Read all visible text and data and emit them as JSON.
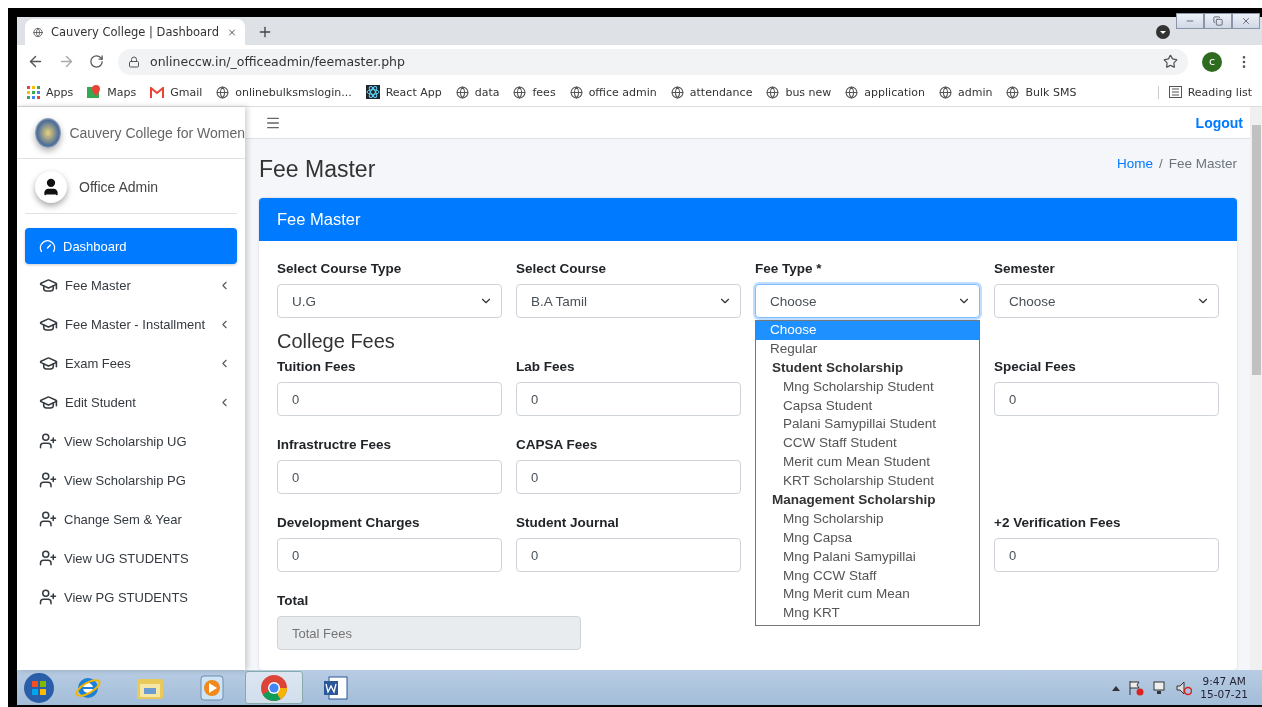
{
  "browser": {
    "tab_title": "Cauvery College | Dashboard",
    "url": "onlineccw.in/_officeadmin/feemaster.php",
    "profile_initial": "c",
    "bookmarks": [
      {
        "label": "Apps",
        "kind": "apps"
      },
      {
        "label": "Maps",
        "kind": "maps"
      },
      {
        "label": "Gmail",
        "kind": "gmail"
      },
      {
        "label": "onlinebulksmslogin...",
        "kind": "globe"
      },
      {
        "label": "React App",
        "kind": "react"
      },
      {
        "label": "data",
        "kind": "globe"
      },
      {
        "label": "fees",
        "kind": "globe"
      },
      {
        "label": "office admin",
        "kind": "globe"
      },
      {
        "label": "attendance",
        "kind": "globe"
      },
      {
        "label": "bus new",
        "kind": "globe"
      },
      {
        "label": "application",
        "kind": "globe"
      },
      {
        "label": "admin",
        "kind": "globe"
      },
      {
        "label": "Bulk SMS",
        "kind": "globe"
      }
    ],
    "reading_list": "Reading list"
  },
  "sidebar": {
    "brand": "Cauvery College for Women",
    "user": "Office Admin",
    "items": [
      {
        "label": "Dashboard",
        "kind": "gauge",
        "selected": true,
        "expandable": false
      },
      {
        "label": "Fee Master",
        "kind": "cap",
        "selected": false,
        "expandable": true
      },
      {
        "label": "Fee Master - Installment",
        "kind": "cap",
        "selected": false,
        "expandable": true
      },
      {
        "label": "Exam Fees",
        "kind": "cap",
        "selected": false,
        "expandable": true
      },
      {
        "label": "Edit Student",
        "kind": "cap",
        "selected": false,
        "expandable": true
      },
      {
        "label": "View Scholarship UG",
        "kind": "person",
        "selected": false,
        "expandable": false
      },
      {
        "label": "View Scholarship PG",
        "kind": "person",
        "selected": false,
        "expandable": false
      },
      {
        "label": "Change Sem & Year",
        "kind": "person",
        "selected": false,
        "expandable": false
      },
      {
        "label": "View UG STUDENTS",
        "kind": "person",
        "selected": false,
        "expandable": false
      },
      {
        "label": "View PG STUDENTS",
        "kind": "person",
        "selected": false,
        "expandable": false
      }
    ]
  },
  "navbar": {
    "logout": "Logout"
  },
  "page": {
    "title": "Fee Master",
    "breadcrumb_separator": "/",
    "breadcrumb": [
      {
        "label": "Home",
        "link": true
      },
      {
        "label": "Fee Master",
        "link": false
      }
    ]
  },
  "card": {
    "title": "Fee Master",
    "selects": [
      {
        "label": "Select Course Type",
        "value": "U.G",
        "focused": false
      },
      {
        "label": "Select Course",
        "value": "B.A Tamil",
        "focused": false
      },
      {
        "label": "Fee Type *",
        "value": "Choose",
        "focused": true,
        "options": [
          {
            "kind": "option",
            "label": "Choose",
            "selected": true
          },
          {
            "kind": "option",
            "label": "Regular",
            "selected": false
          },
          {
            "kind": "group",
            "label": "Student Scholarship",
            "children": [
              {
                "label": "Mng Scholarship Student",
                "selected": false
              },
              {
                "label": "Capsa Student",
                "selected": false
              },
              {
                "label": "Palani Samypillai Student",
                "selected": false
              },
              {
                "label": "CCW Staff Student",
                "selected": false
              },
              {
                "label": "Merit cum Mean Student",
                "selected": false
              },
              {
                "label": "KRT Scholarship Student",
                "selected": false
              }
            ]
          },
          {
            "kind": "group",
            "label": "Management Scholarship",
            "children": [
              {
                "label": "Mng Scholarship",
                "selected": false
              },
              {
                "label": "Mng Capsa",
                "selected": false
              },
              {
                "label": "Mng Palani Samypillai",
                "selected": false
              },
              {
                "label": "Mng CCW Staff",
                "selected": false
              },
              {
                "label": "Mng Merit cum Mean",
                "selected": false
              },
              {
                "label": "Mng KRT",
                "selected": false
              }
            ]
          }
        ]
      },
      {
        "label": "Semester",
        "value": "Choose",
        "focused": false
      }
    ],
    "section_title": "College Fees",
    "fee_rows": [
      [
        {
          "kind": "field",
          "label": "Tuition Fees",
          "value": "0"
        },
        {
          "kind": "field",
          "label": "Lab Fees",
          "value": "0"
        },
        {
          "kind": "blank"
        },
        {
          "kind": "field",
          "label": "Special Fees",
          "value": "0"
        }
      ],
      [
        {
          "kind": "field",
          "label": "Infrastructre Fees",
          "value": "0"
        },
        {
          "kind": "field",
          "label": "CAPSA Fees",
          "value": "0"
        },
        {
          "kind": "blank"
        },
        {
          "kind": "blank"
        }
      ],
      [
        {
          "kind": "field",
          "label": "Development Charges",
          "value": "0"
        },
        {
          "kind": "field",
          "label": "Student Journal",
          "value": "0"
        },
        {
          "kind": "blank"
        },
        {
          "kind": "field",
          "label": "+2 Verification Fees",
          "value": "0"
        }
      ]
    ],
    "total": {
      "label": "Total",
      "placeholder": "Total Fees"
    }
  },
  "taskbar": {
    "apps": [
      {
        "kind": "ie",
        "active": false
      },
      {
        "kind": "explorer",
        "active": false
      },
      {
        "kind": "media",
        "active": false
      },
      {
        "kind": "chrome",
        "active": true
      },
      {
        "kind": "word",
        "active": false
      }
    ],
    "time": "9:47 AM",
    "date": "15-07-21"
  }
}
